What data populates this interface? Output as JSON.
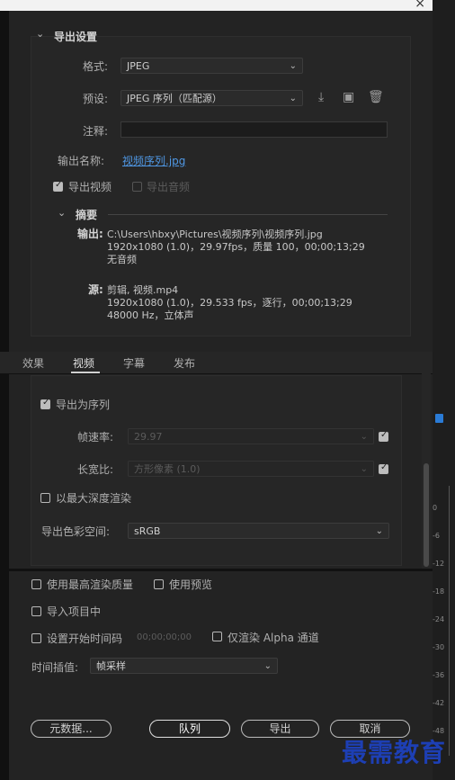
{
  "export_settings": {
    "section_title": "导出设置",
    "format": {
      "label": "格式:",
      "value": "JPEG"
    },
    "preset": {
      "label": "预设:",
      "value": "JPEG 序列（匹配源）"
    },
    "comments": {
      "label": "注释:",
      "value": ""
    },
    "output_name": {
      "label": "输出名称:",
      "value": "视频序列.jpg"
    },
    "export_video": {
      "label": "导出视频",
      "checked": true
    },
    "export_audio": {
      "label": "导出音频",
      "checked": false
    }
  },
  "summary": {
    "title": "摘要",
    "output_key": "输出:",
    "output_lines": [
      "C:\\Users\\hbxy\\Pictures\\视频序列\\视频序列.jpg",
      "1920x1080 (1.0)，29.97fps，质量 100，00;00;13;29",
      "无音频"
    ],
    "source_key": "源:",
    "source_lines": [
      "剪辑, 视频.mp4",
      "1920x1080 (1.0)，29.533 fps，逐行，00;00;13;29",
      "48000 Hz，立体声"
    ]
  },
  "tabs": [
    "效果",
    "视频",
    "字幕",
    "发布"
  ],
  "active_tab": 1,
  "video": {
    "export_as_sequence": {
      "label": "导出为序列",
      "checked": true
    },
    "frame_rate": {
      "label": "帧速率:",
      "value": "29.97",
      "checked": true
    },
    "aspect": {
      "label": "长宽比:",
      "value": "方形像素 (1.0)",
      "checked": true
    },
    "max_depth": {
      "label": "以最大深度渲染",
      "checked": false
    },
    "color_space": {
      "label": "导出色彩空间:",
      "value": "sRGB"
    }
  },
  "bottom": {
    "max_quality": {
      "label": "使用最高渲染质量",
      "checked": false
    },
    "use_previews": {
      "label": "使用预览",
      "checked": false
    },
    "import_project": {
      "label": "导入项目中",
      "checked": false
    },
    "start_timecode": {
      "label": "设置开始时间码",
      "value": "00;00;00;00",
      "checked": false
    },
    "render_alpha": {
      "label": "仅渲染 Alpha 通道",
      "checked": false
    },
    "time_interp": {
      "label": "时间插值:",
      "value": "帧采样"
    }
  },
  "buttons": {
    "metadata": "元数据...",
    "queue": "队列",
    "export": "导出",
    "cancel": "取消"
  },
  "right_ticks": [
    "0",
    "-6",
    "-12",
    "-18",
    "-24",
    "-30",
    "-36",
    "-42",
    "-48"
  ],
  "window": {
    "close": "×"
  },
  "watermark": "最需教育"
}
